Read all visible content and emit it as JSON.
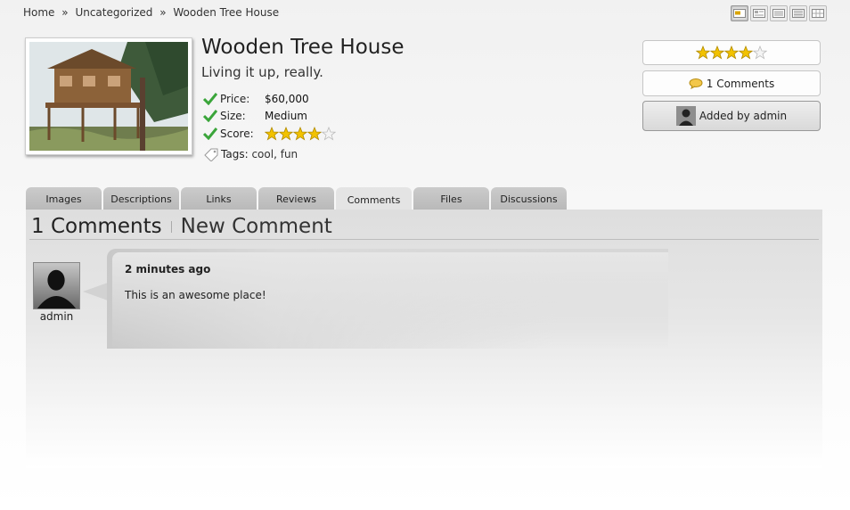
{
  "breadcrumb": {
    "home": "Home",
    "separator": "»",
    "category": "Uncategorized",
    "current": "Wooden Tree House"
  },
  "view_switcher": {
    "icons": [
      "card-view-icon",
      "list-thumb-view-icon",
      "compact-view-icon",
      "detail-view-icon",
      "grid-view-icon"
    ],
    "active_index": 0
  },
  "listing": {
    "title": "Wooden Tree House",
    "subtitle": "Living it up, really.",
    "details": [
      {
        "label": "Price:",
        "value": "$60,000"
      },
      {
        "label": "Size:",
        "value": "Medium"
      },
      {
        "label": "Score:",
        "stars": 4,
        "max_stars": 5
      }
    ],
    "tags_label": "Tags:",
    "tags": [
      "cool",
      "fun"
    ],
    "tag_separator": ","
  },
  "sidebar": {
    "rating_stars": 4,
    "rating_max": 5,
    "comments_link": "1 Comments",
    "added_by": "Added by admin"
  },
  "tabs": [
    {
      "label": "Images"
    },
    {
      "label": "Descriptions"
    },
    {
      "label": "Links"
    },
    {
      "label": "Reviews"
    },
    {
      "label": "Comments",
      "active": true
    },
    {
      "label": "Files"
    },
    {
      "label": "Discussions"
    }
  ],
  "comments_panel": {
    "count_title": "1 Comments",
    "new_comment": "New Comment",
    "comments": [
      {
        "author": "admin",
        "time": "2 minutes ago",
        "text": "This is an awesome place!"
      }
    ]
  },
  "colors": {
    "check_green": "#3aa53a",
    "star_gold": "#f2c200",
    "tab_bg": "#c4c4c4",
    "tab_active": "#e4e4e4"
  }
}
